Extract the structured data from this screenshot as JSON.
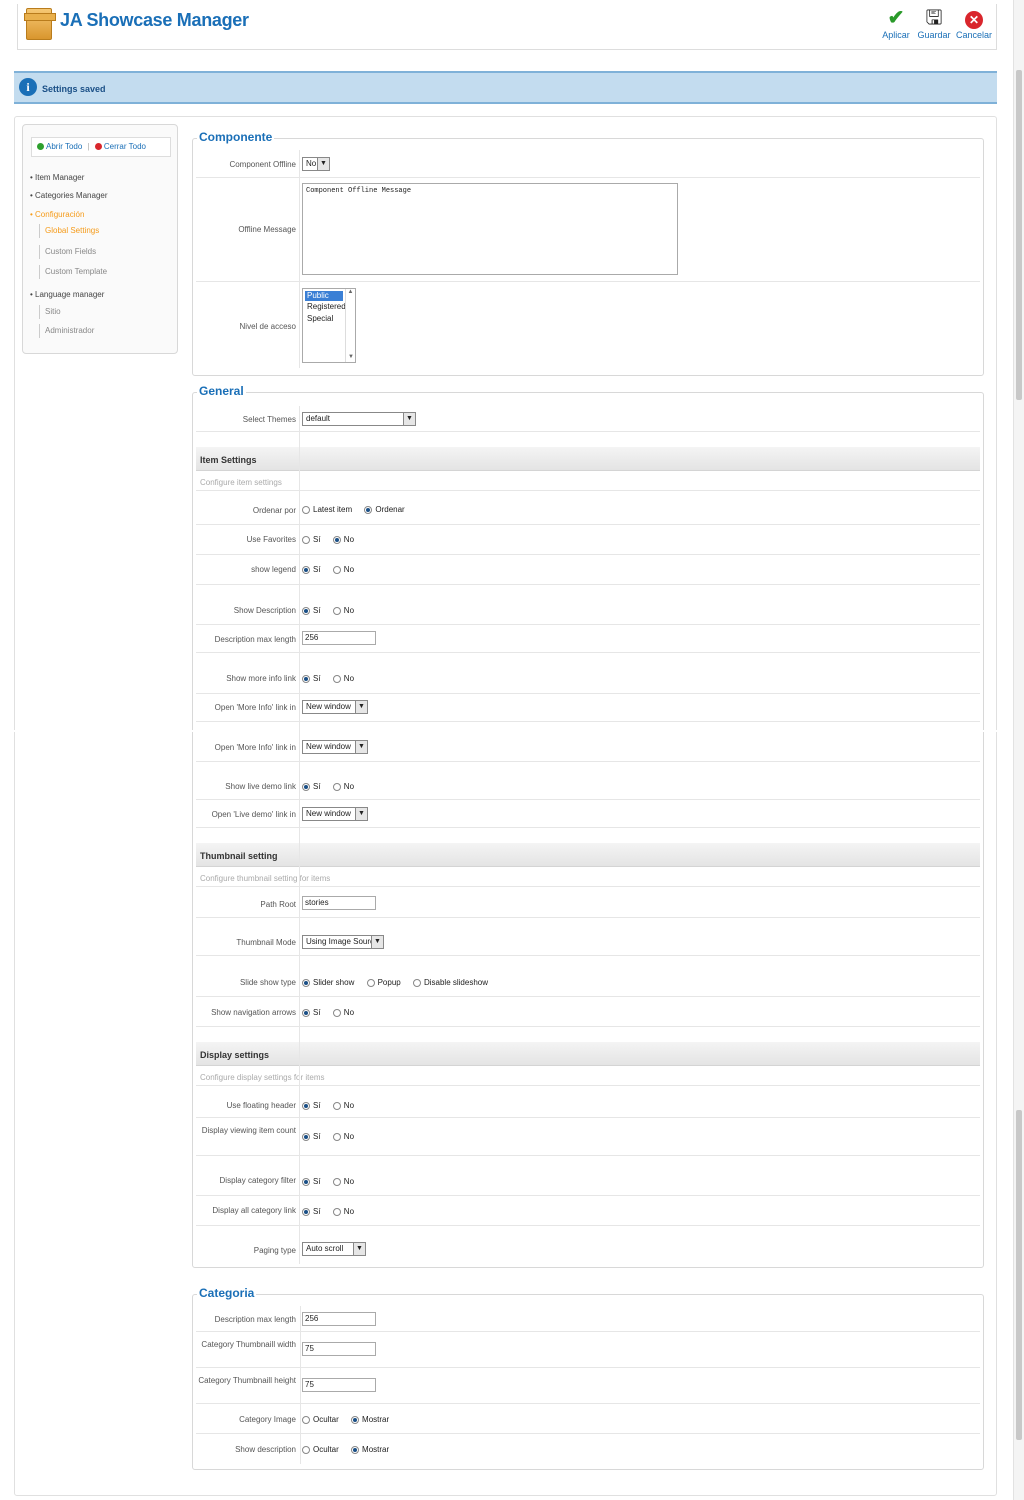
{
  "header": {
    "title": "JA Showcase Manager",
    "apply": "Aplicar",
    "save": "Guardar",
    "cancel": "Cancelar"
  },
  "message": "Settings saved",
  "sidebar": {
    "open_all": "Abrir Todo",
    "close_all": "Cerrar Todo",
    "items": {
      "item_manager": "• Item Manager",
      "categories_manager": "• Categories Manager",
      "configuracion": "• Configuración",
      "global_settings": "Global Settings",
      "custom_fields": "Custom Fields",
      "custom_template": "Custom Template",
      "language_manager": "• Language manager",
      "sitio": "Sitio",
      "administrador": "Administrador"
    }
  },
  "componente": {
    "legend": "Componente",
    "offline_label": "Component Offline",
    "offline_value": "No",
    "message_label": "Offline Message",
    "message_value": "Component Offline Message",
    "access_label": "Nivel de acceso",
    "access_options": [
      "Public",
      "Registered",
      "Special"
    ],
    "access_selected": "Public"
  },
  "general": {
    "legend": "General",
    "themes_label": "Select Themes",
    "themes_value": "default"
  },
  "item_settings": {
    "title": "Item Settings",
    "desc": "Configure item settings",
    "ordenar_label": "Ordenar por",
    "ordenar_opt1": "Latest item",
    "ordenar_opt2": "Ordenar",
    "favorites_label": "Use Favorites",
    "legend_label": "show legend",
    "showdesc_label": "Show Description",
    "descmax_label": "Description max length",
    "descmax_value": "256",
    "moreinfo_label": "Show more info link",
    "openmore_label": "Open 'More Info' link in",
    "openmore_value": "New window",
    "livedemo_label": "Show live demo link",
    "openlive_label": "Open 'Live demo' link in",
    "openlive_value": "New window"
  },
  "yes": "Sí",
  "no": "No",
  "thumbnail": {
    "title": "Thumbnail setting",
    "desc": "Configure thumbnail setting for items",
    "path_label": "Path Root",
    "path_value": "stories",
    "mode_label": "Thumbnail Mode",
    "mode_value": "Using Image Source",
    "slide_label": "Slide show type",
    "slide_opt1": "Slider show",
    "slide_opt2": "Popup",
    "slide_opt3": "Disable slideshow",
    "arrows_label": "Show navigation arrows"
  },
  "display": {
    "title": "Display settings",
    "desc": "Configure display settings for items",
    "floating_label": "Use floating header",
    "viewing_label": "Display viewing item count",
    "catfilter_label": "Display category filter",
    "allcat_label": "Display all category link",
    "paging_label": "Paging type",
    "paging_value": "Auto scroll"
  },
  "categoria": {
    "legend": "Categoria",
    "descmax_label": "Description max length",
    "descmax_value": "256",
    "thumbw_label": "Category Thumbnaill width",
    "thumbw_value": "75",
    "thumbh_label": "Category Thumbnaill height",
    "thumbh_value": "75",
    "image_label": "Category Image",
    "showdesc_label": "Show description",
    "hide": "Ocultar",
    "show": "Mostrar"
  }
}
